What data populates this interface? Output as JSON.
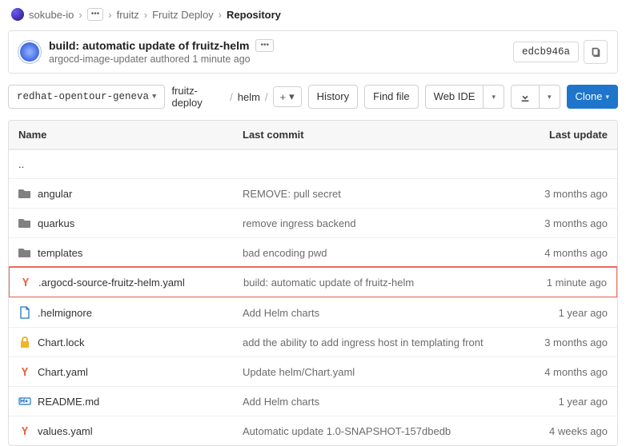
{
  "breadcrumbs": {
    "root_icon": "sokube-avatar",
    "root": "sokube-io",
    "ellipsis": "•••",
    "items": [
      "fruitz",
      "Fruitz Deploy",
      "Repository"
    ]
  },
  "last_commit": {
    "title": "build: automatic update of fruitz-helm",
    "ellipsis": "•••",
    "author": "argocd-image-updater",
    "verb": "authored",
    "when": "1 minute ago",
    "sha": "edcb946a"
  },
  "toolbar": {
    "branch": "redhat-opentour-geneva",
    "path": [
      "fruitz-deploy",
      "helm"
    ],
    "plus": "+",
    "history": "History",
    "find": "Find file",
    "webide": "Web IDE",
    "download_icon": "download",
    "clone": "Clone"
  },
  "table": {
    "headers": {
      "name": "Name",
      "commit": "Last commit",
      "updated": "Last update"
    },
    "updir": "..",
    "rows": [
      {
        "icon": "folder",
        "name": "angular",
        "commit": "REMOVE: pull secret",
        "updated": "3 months ago",
        "hl": false
      },
      {
        "icon": "folder",
        "name": "quarkus",
        "commit": "remove ingress backend",
        "updated": "3 months ago",
        "hl": false
      },
      {
        "icon": "folder",
        "name": "templates",
        "commit": "bad encoding pwd",
        "updated": "4 months ago",
        "hl": false
      },
      {
        "icon": "yaml",
        "name": ".argocd-source-fruitz-helm.yaml",
        "commit": "build: automatic update of fruitz-helm",
        "updated": "1 minute ago",
        "hl": true
      },
      {
        "icon": "doc-blue",
        "name": ".helmignore",
        "commit": "Add Helm charts",
        "updated": "1 year ago",
        "hl": false
      },
      {
        "icon": "lock",
        "name": "Chart.lock",
        "commit": "add the ability to add ingress host in templating front",
        "updated": "3 months ago",
        "hl": false
      },
      {
        "icon": "yaml",
        "name": "Chart.yaml",
        "commit": "Update helm/Chart.yaml",
        "updated": "4 months ago",
        "hl": false
      },
      {
        "icon": "md",
        "name": "README.md",
        "commit": "Add Helm charts",
        "updated": "1 year ago",
        "hl": false
      },
      {
        "icon": "yaml",
        "name": "values.yaml",
        "commit": "Automatic update 1.0-SNAPSHOT-157dbedb",
        "updated": "4 weeks ago",
        "hl": false
      }
    ]
  }
}
